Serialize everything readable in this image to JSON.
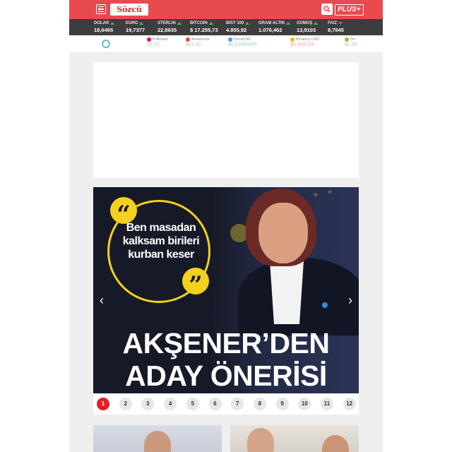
{
  "header": {
    "logo_text": "Sözcü",
    "plus_label": "PLUS+"
  },
  "markets": [
    {
      "name": "DOLAR",
      "value": "18,6495",
      "trend": "up"
    },
    {
      "name": "EURO",
      "value": "19,7377",
      "trend": "up"
    },
    {
      "name": "STERLIN",
      "value": "22,8635",
      "trend": "up"
    },
    {
      "name": "BITCOIN",
      "value": "$ 17.255,73",
      "trend": "up"
    },
    {
      "name": "BIST 100",
      "value": "4.855,92",
      "trend": "up"
    },
    {
      "name": "GRAM ALTIN",
      "value": "1.076,462",
      "trend": "up"
    },
    {
      "name": "GÜMÜŞ",
      "value": "13,9103",
      "trend": "up"
    },
    {
      "name": "FAIZ",
      "value": "8,7845",
      "trend": "down"
    }
  ],
  "crypto": [
    {
      "name": "Polkadot",
      "value": "$5.52",
      "color": "#e6007a"
    },
    {
      "name": "Avalanche",
      "value": "$13.42",
      "color": "#e84142"
    },
    {
      "name": "TerraUSD",
      "value": "$0.02969965",
      "color": "#5493f7"
    },
    {
      "name": "Binance USD",
      "value": "$0.999724",
      "color": "#f0b90b"
    },
    {
      "name": "Do",
      "value": "$0.09",
      "color": "#c2a633"
    }
  ],
  "slider": {
    "quote": "Ben masadan kalksam birileri kurban keser",
    "headline_line1": "AKŞENER’DEN",
    "headline_line2": "ADAY ÖNERİSİ",
    "pages": [
      "1",
      "2",
      "3",
      "4",
      "5",
      "6",
      "7",
      "8",
      "9",
      "10",
      "11",
      "12"
    ],
    "active_page": "1"
  },
  "colors": {
    "brand_red": "#e84a4f",
    "market_bar": "#3d3d3d",
    "quote_yellow": "#f5d11c",
    "active_page": "#e21f26"
  }
}
